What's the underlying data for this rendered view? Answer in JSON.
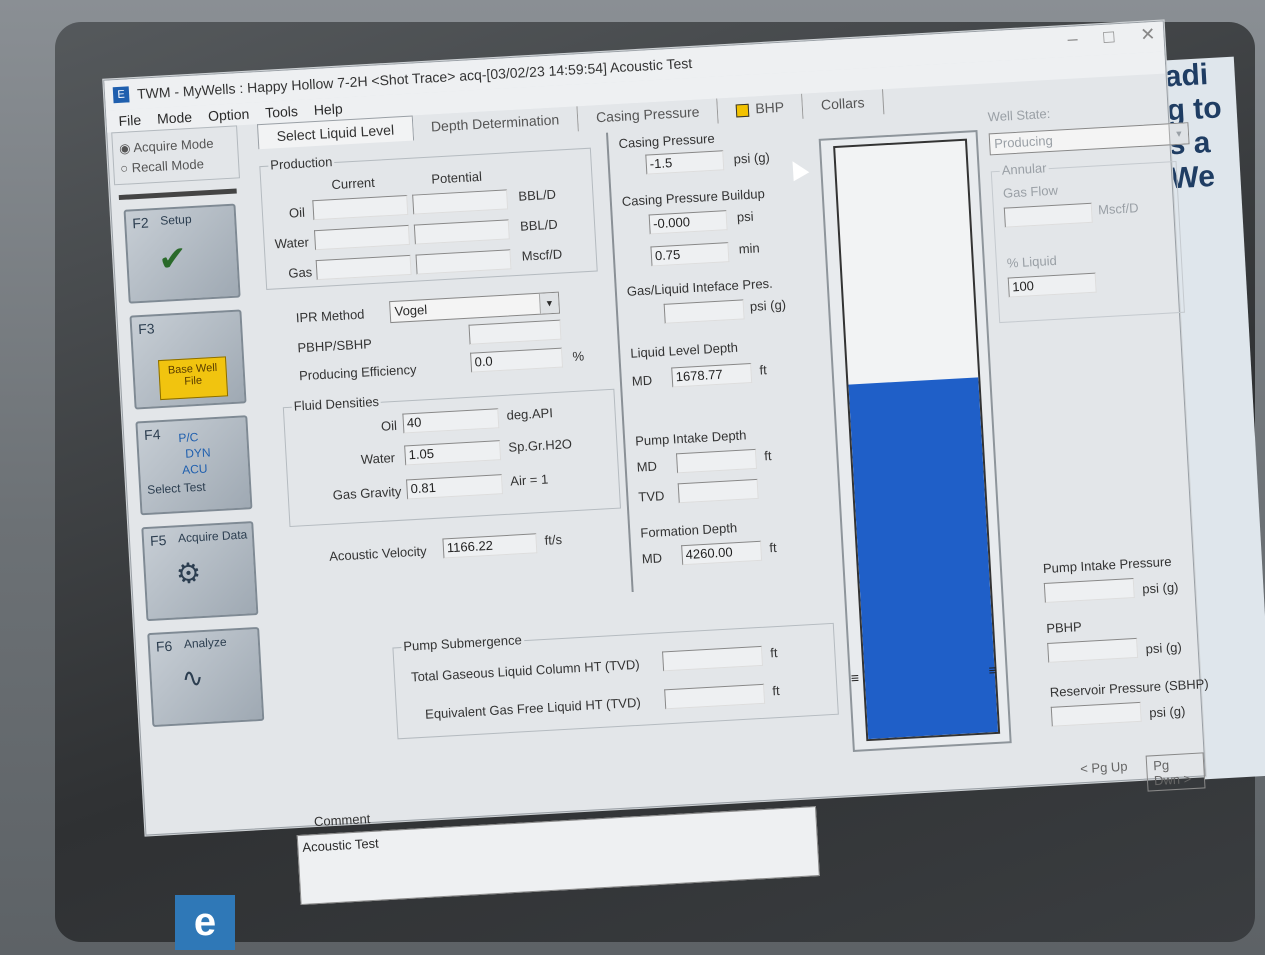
{
  "window": {
    "title": "TWM - MyWells : Happy Hollow 7-2H <Shot Trace> acq-[03/02/23 14:59:54] Acoustic Test",
    "app_icon": "E",
    "controls": [
      "–",
      "□",
      "✕"
    ]
  },
  "menu": [
    "File",
    "Mode",
    "Option",
    "Tools",
    "Help"
  ],
  "modes": {
    "acquire": "Acquire Mode",
    "recall": "Recall Mode"
  },
  "fbuttons": [
    {
      "key": "F2",
      "label": "Setup"
    },
    {
      "key": "F3",
      "label": "",
      "folder": "Base Well File"
    },
    {
      "key": "F4",
      "label": "Select Test",
      "stack": [
        "P/C",
        "DYN",
        "ACU"
      ]
    },
    {
      "key": "F5",
      "label": "Acquire Data"
    },
    {
      "key": "F6",
      "label": "Analyze"
    }
  ],
  "tabs": [
    "Select Liquid Level",
    "Depth Determination",
    "Casing Pressure",
    "BHP",
    "Collars"
  ],
  "production": {
    "title": "Production",
    "current": "Current",
    "potential": "Potential",
    "oil": "Oil",
    "water": "Water",
    "gas": "Gas",
    "bbl1": "BBL/D",
    "bbl2": "BBL/D",
    "mscf": "Mscf/D"
  },
  "ipr": {
    "label": "IPR Method",
    "value": "Vogel"
  },
  "pbhp": {
    "label": "PBHP/SBHP",
    "value": ""
  },
  "eff": {
    "label": "Producing Efficiency",
    "value": "0.0",
    "unit": "%"
  },
  "fluid": {
    "title": "Fluid Densities",
    "oil_label": "Oil",
    "oil": "40",
    "oil_unit": "deg.API",
    "water_label": "Water",
    "water": "1.05",
    "water_unit": "Sp.Gr.H2O",
    "gas_label": "Gas Gravity",
    "gas": "0.81",
    "gas_unit": "Air = 1"
  },
  "velocity": {
    "label": "Acoustic Velocity",
    "value": "1166.22",
    "unit": "ft/s"
  },
  "casing": {
    "title": "Casing Pressure",
    "value": "-1.5",
    "unit": "psi (g)",
    "buildup_title": "Casing Pressure Buildup",
    "buildup": "-0.000",
    "buildup_unit": "psi",
    "time": "0.75",
    "time_unit": "min"
  },
  "gli": {
    "title": "Gas/Liquid Inteface Pres.",
    "value": "",
    "unit": "psi (g)"
  },
  "lld": {
    "title": "Liquid Level Depth",
    "md_label": "MD",
    "value": "1678.77",
    "unit": "ft"
  },
  "pid": {
    "title": "Pump Intake Depth",
    "md_label": "MD",
    "md": "",
    "md_unit": "ft",
    "tvd_label": "TVD",
    "tvd": ""
  },
  "formation": {
    "title": "Formation Depth",
    "md_label": "MD",
    "value": "4260.00",
    "unit": "ft"
  },
  "submergence": {
    "title": "Pump Submergence",
    "total": "Total Gaseous Liquid Column HT (TVD)",
    "total_unit": "ft",
    "equiv": "Equivalent Gas Free Liquid HT (TVD)",
    "equiv_unit": "ft"
  },
  "comment": {
    "label": "Comment",
    "value": "Acoustic Test"
  },
  "wellstate": {
    "label": "Well State:",
    "value": "Producing",
    "annular": "Annular",
    "gasflow": "Gas Flow",
    "gasflow_unit": "Mscf/D",
    "liquid_label": "% Liquid",
    "liquid": "100"
  },
  "right": {
    "pip": "Pump Intake Pressure",
    "pip_unit": "psi (g)",
    "pbhp": "PBHP",
    "pbhp_unit": "psi (g)",
    "sbhp": "Reservoir Pressure (SBHP)",
    "sbhp_unit": "psi (g)"
  },
  "gauge": {
    "liquid_fraction": 0.6
  },
  "paging": {
    "up": "< Pg Up",
    "down": "Pg Dwn >"
  },
  "background_text": [
    "adi",
    "g to",
    "s a",
    "We"
  ],
  "taskbar": {
    "icon": "e"
  }
}
